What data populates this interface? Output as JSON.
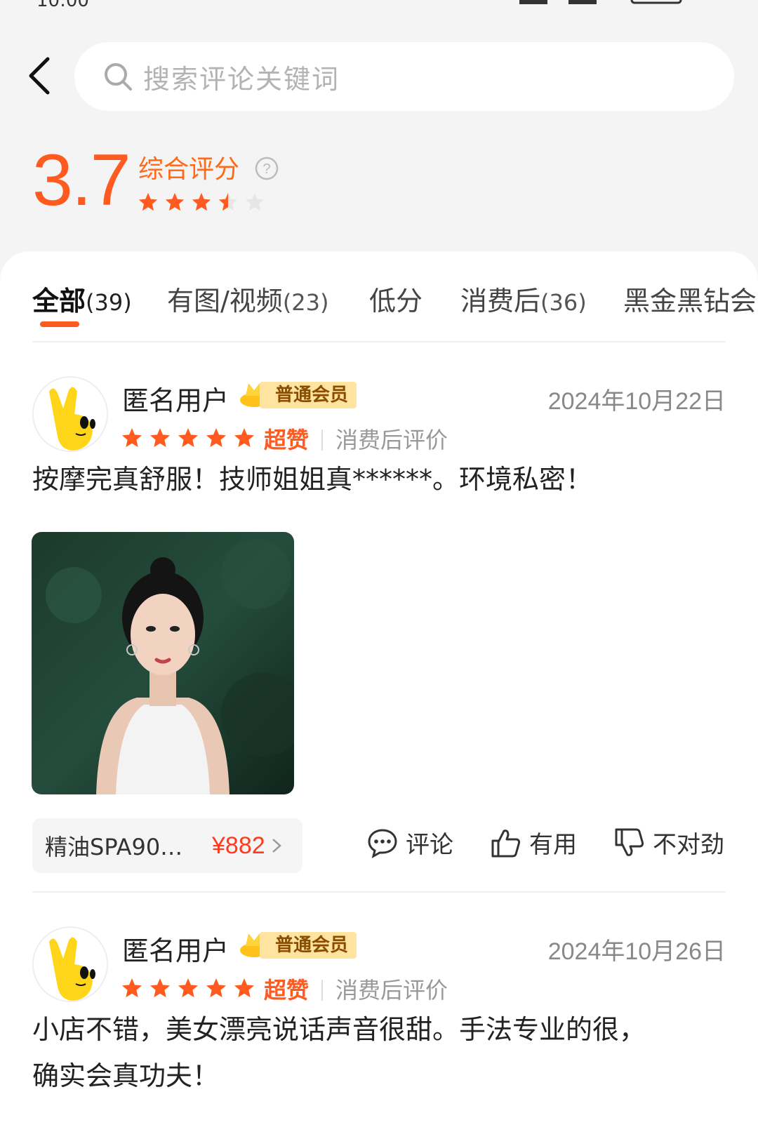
{
  "status_bar": {
    "time": "10:00"
  },
  "search": {
    "placeholder": "搜索评论关键词"
  },
  "rating": {
    "score": "3.7",
    "label": "综合评分",
    "stars_value": 3.5
  },
  "tabs": [
    {
      "label": "全部",
      "count": "(39)"
    },
    {
      "label": "有图/视频",
      "count": "(23)"
    },
    {
      "label": "低分",
      "count": ""
    },
    {
      "label": "消费后",
      "count": "(36)"
    },
    {
      "label": "黑金黑钻会",
      "count": ""
    }
  ],
  "reviews": [
    {
      "username": "匿名用户",
      "member_label": "普通会员",
      "date": "2024年10月22日",
      "stars": 5,
      "praise": "超赞",
      "tag": "消费后评价",
      "text": "按摩完真舒服！技师姐姐真******。环境私密！",
      "product": {
        "name": "精油SPA90…",
        "price": "¥882"
      },
      "actions": {
        "comment": "评论",
        "useful": "有用",
        "wrong": "不对劲"
      }
    },
    {
      "username": "匿名用户",
      "member_label": "普通会员",
      "date": "2024年10月26日",
      "stars": 5,
      "praise": "超赞",
      "tag": "消费后评价",
      "text_line1": "小店不错，美女漂亮说话声音很甜。手法专业的很，",
      "text_line2": "确实会真功夫！"
    }
  ],
  "colors": {
    "accent": "#ff5a1f",
    "background": "#f4f4f4",
    "badge": "#ffe3a0"
  }
}
